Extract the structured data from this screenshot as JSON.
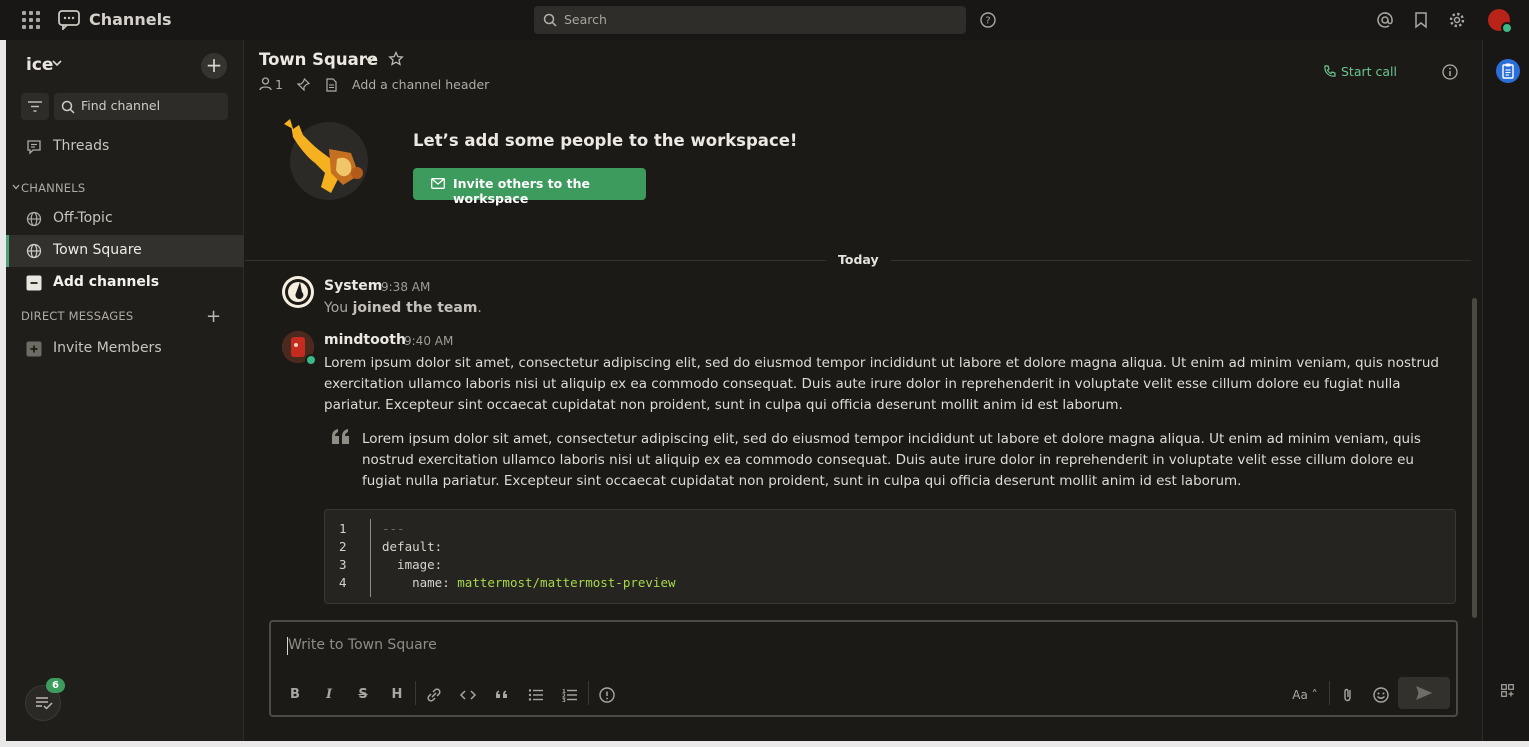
{
  "app": {
    "product_name": "Channels",
    "search_placeholder": "Search"
  },
  "sidebar": {
    "team_name": "ice",
    "find_channel": "Find channel",
    "threads_label": "Threads",
    "channels_header": "CHANNELS",
    "channels": [
      {
        "label": "Off-Topic",
        "icon": "globe-icon",
        "active": false
      },
      {
        "label": "Town Square",
        "icon": "globe-icon",
        "active": true
      }
    ],
    "add_channels_label": "Add channels",
    "dm_header": "DIRECT MESSAGES",
    "invite_members_label": "Invite Members",
    "threads_badge_count": "6"
  },
  "channel": {
    "title": "Town Square",
    "member_count": "1",
    "add_header_label": "Add a channel header",
    "start_call_label": "Start call"
  },
  "intro": {
    "title": "Let’s add some people to the workspace!",
    "invite_button": "Invite others to the workspace"
  },
  "date_separator": "Today",
  "posts": [
    {
      "author": "System",
      "time": "9:38 AM",
      "message_prefix": "You ",
      "message_bold": "joined the team",
      "message_suffix": "."
    },
    {
      "author": "mindtooth",
      "time": "9:40 AM",
      "body": "Lorem ipsum dolor sit amet, consectetur adipiscing elit, sed do eiusmod tempor incididunt ut labore et dolore magna aliqua. Ut enim ad minim veniam, quis nostrud exercitation ullamco laboris nisi ut aliquip ex ea commodo consequat. Duis aute irure dolor in reprehenderit in voluptate velit esse cillum dolore eu fugiat nulla pariatur. Excepteur sint occaecat cupidatat non proident, sunt in culpa qui officia deserunt mollit anim id est laborum.",
      "quote": "Lorem ipsum dolor sit amet, consectetur adipiscing elit, sed do eiusmod tempor incididunt ut labore et dolore magna aliqua. Ut enim ad minim veniam, quis nostrud exercitation ullamco laboris nisi ut aliquip ex ea commodo consequat. Duis aute irure dolor in reprehenderit in voluptate velit esse cillum dolore eu fugiat nulla pariatur. Excepteur sint occaecat cupidatat non proident, sunt in culpa qui officia deserunt mollit anim id est laborum.",
      "code": {
        "line_numbers": [
          "1",
          "2",
          "3",
          "4"
        ],
        "line1": "---",
        "line2": "default:",
        "line3": "  image:",
        "line4_key": "    name: ",
        "line4_value": "mattermost/mattermost-preview"
      }
    }
  ],
  "composer": {
    "placeholder": "Write to Town Square",
    "toolbar": {
      "bold": "B",
      "italic": "I",
      "strike": "S",
      "heading": "H",
      "font_size": "Aa"
    }
  },
  "colors": {
    "accent_green": "#3e9b5e",
    "online_status": "#3db887",
    "sidebar_bg": "#1f1e1a",
    "center_bg": "#1b1a17",
    "code_string": "#a6d84a"
  }
}
